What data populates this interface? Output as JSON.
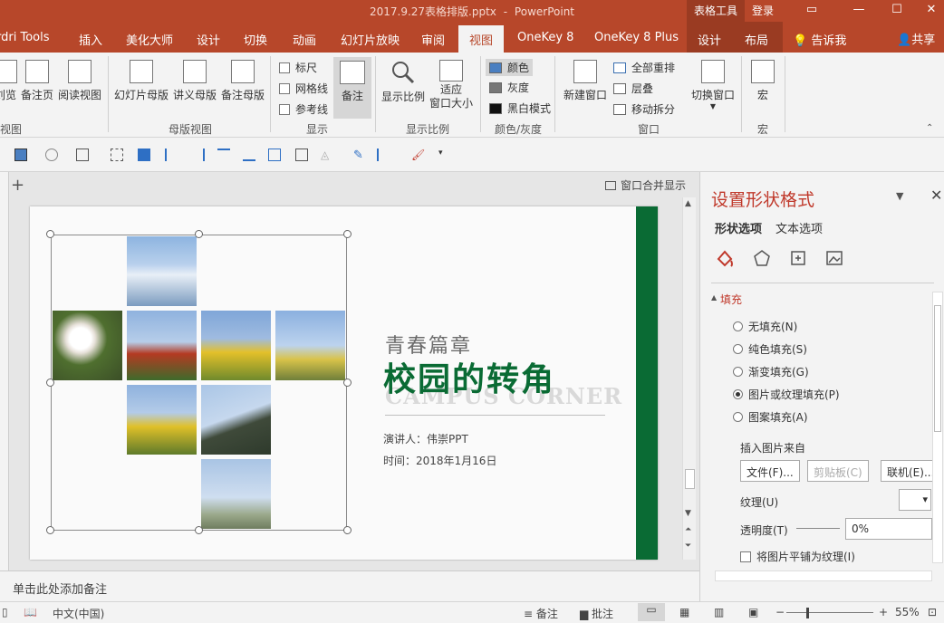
{
  "window": {
    "filename": "2017.9.27表格排版.pptx",
    "separator": "-",
    "app": "PowerPoint",
    "tool_context": "表格工具",
    "login": "登录"
  },
  "tabs": [
    {
      "label": "rdri Tools"
    },
    {
      "label": "插入"
    },
    {
      "label": "美化大师"
    },
    {
      "label": "设计"
    },
    {
      "label": "切换"
    },
    {
      "label": "动画"
    },
    {
      "label": "幻灯片放映"
    },
    {
      "label": "审阅"
    },
    {
      "label": "视图"
    },
    {
      "label": "OneKey 8"
    },
    {
      "label": "OneKey 8 Plus"
    },
    {
      "label": "设计"
    },
    {
      "label": "布局"
    }
  ],
  "tell_me": "告诉我",
  "share": "共享",
  "ribbon": {
    "views": {
      "partial_label": "刘览",
      "notes_page": "备注页",
      "reading_view": "阅读视图",
      "group": "视图"
    },
    "master": {
      "slide_master": "幻灯片母版",
      "handout_master": "讲义母版",
      "notes_master": "备注母版",
      "group": "母版视图"
    },
    "show": {
      "ruler": "标尺",
      "gridlines": "网格线",
      "guides": "参考线",
      "notes": "备注",
      "group": "显示"
    },
    "zoom": {
      "zoom": "显示比例",
      "fit": "适应\n窗口大小",
      "fit_l1": "适应",
      "fit_l2": "窗口大小",
      "group": "显示比例"
    },
    "color": {
      "color": "颜色",
      "grayscale": "灰度",
      "bw": "黑白模式",
      "group": "颜色/灰度"
    },
    "window": {
      "new_window": "新建窗口",
      "arrange_all": "全部重排",
      "cascade": "层叠",
      "move_split": "移动拆分",
      "group": "窗口"
    },
    "switch": {
      "switch_windows": "切换窗口"
    },
    "macros": {
      "macros": "宏",
      "group": "宏"
    }
  },
  "editor": {
    "merge_display": "窗口合并显示",
    "slide": {
      "subtitle": "青春篇章",
      "title": "校园的转角",
      "en": "CAMPUS CORNER",
      "speaker": "演讲人：伟崇PPT",
      "date": "时间：2018年1月16日"
    },
    "notes_placeholder": "单击此处添加备注"
  },
  "pane": {
    "title": "设置形状格式",
    "tab_shape": "形状选项",
    "tab_text": "文本选项",
    "fill_header": "填充",
    "fills": [
      {
        "label": "无填充(N)",
        "selected": false
      },
      {
        "label": "纯色填充(S)",
        "selected": false
      },
      {
        "label": "渐变填充(G)",
        "selected": false
      },
      {
        "label": "图片或纹理填充(P)",
        "selected": true
      },
      {
        "label": "图案填充(A)",
        "selected": false
      }
    ],
    "insert_from": "插入图片来自",
    "file_btn": "文件(F)...",
    "clipboard_btn": "剪贴板(C)",
    "online_btn": "联机(E)...",
    "texture_label": "纹理(U)",
    "transparency_label": "透明度(T)",
    "transparency_value": "0%",
    "tile_label": "将图片平铺为纹理(I)"
  },
  "status": {
    "language": "中文(中国)",
    "notes": "备注",
    "comments": "批注",
    "zoom": "55%"
  },
  "colors": {
    "titlebar": "#b7472a",
    "context_tab": "#9a3b22",
    "slide_green": "#0a6b34",
    "pane_accent": "#c0392b"
  }
}
